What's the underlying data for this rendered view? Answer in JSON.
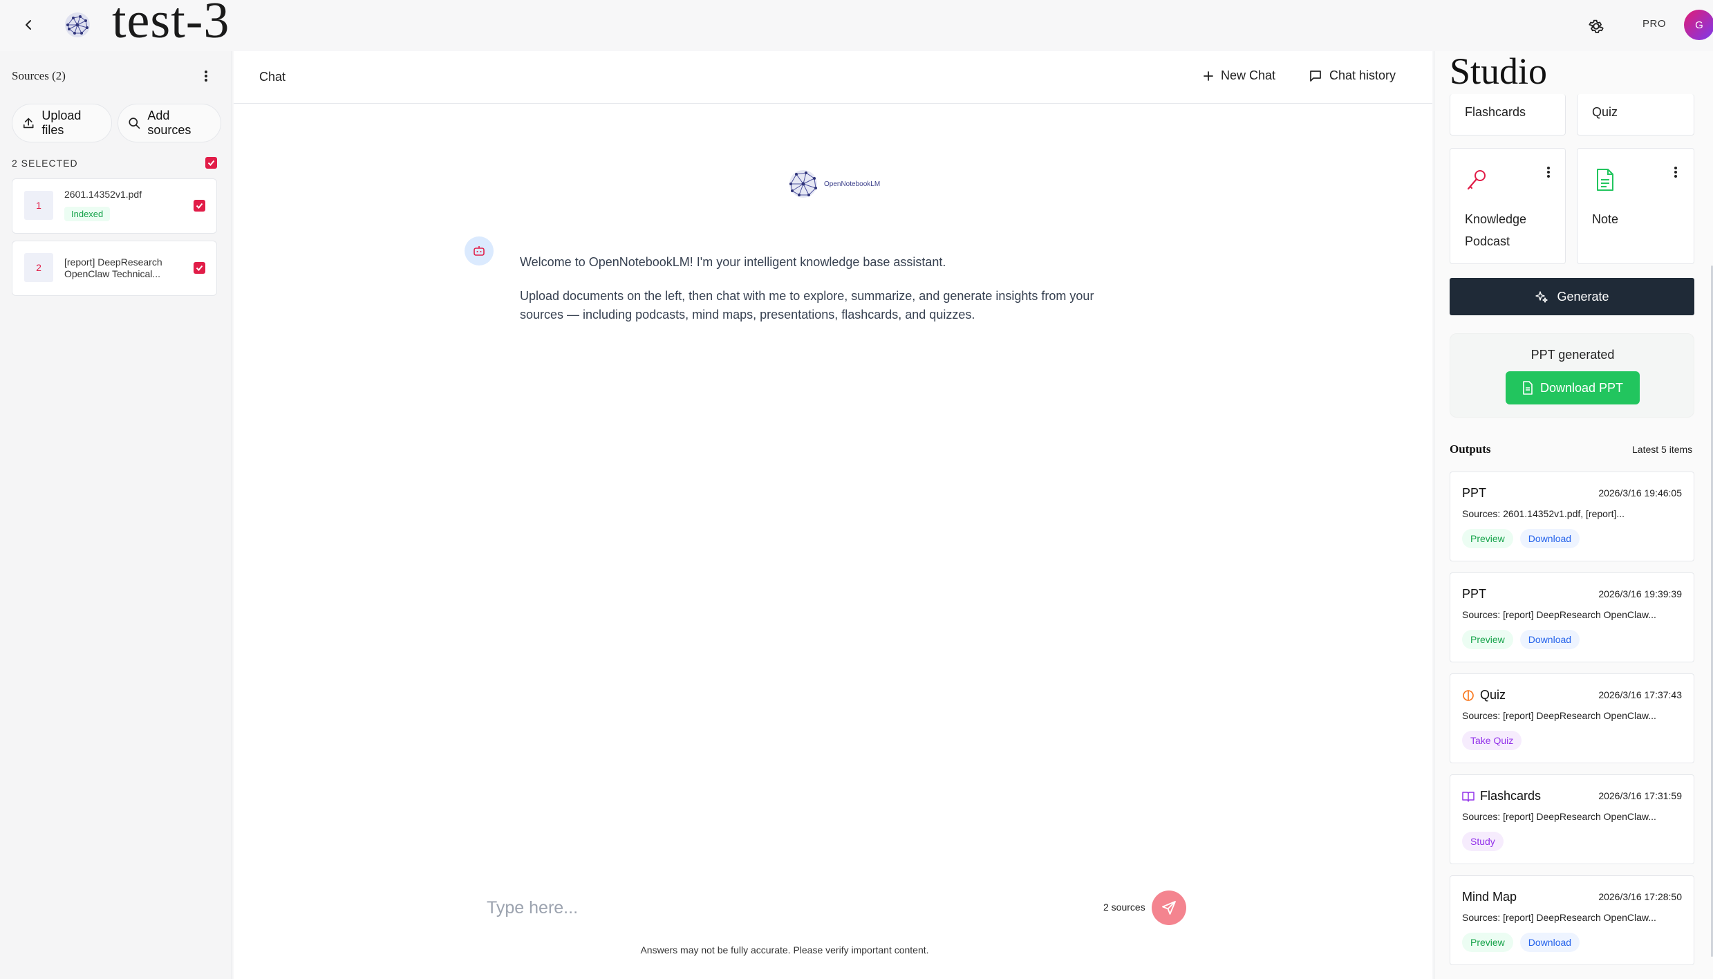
{
  "header": {
    "notebook_title": "test-3",
    "pro_label": "PRO",
    "avatar_initial": "G"
  },
  "sources_panel": {
    "title": "Sources (2)",
    "upload_label": "Upload files",
    "add_label": "Add sources",
    "selected_label": "2 SELECTED",
    "items": [
      {
        "number": "1",
        "name": "2601.14352v1.pdf",
        "status": "Indexed"
      },
      {
        "number": "2",
        "name_line1": "[report] DeepResearch",
        "name_line2": "OpenClaw Technical..."
      }
    ]
  },
  "chat": {
    "title": "Chat",
    "new_chat_label": "New Chat",
    "history_label": "Chat history",
    "logo_text": "OpenNotebookLM",
    "welcome_line1": "Welcome to OpenNotebookLM! I'm your intelligent knowledge base assistant.",
    "welcome_line2": "Upload documents on the left, then chat with me to explore, summarize, and generate insights from your sources — including podcasts, mind maps, presentations, flashcards, and quizzes.",
    "input_placeholder": "Type here...",
    "source_count": "2 sources",
    "disclaimer": "Answers may not be fully accurate. Please verify important content."
  },
  "studio": {
    "title": "Studio",
    "tiles": {
      "flashcards": "Flashcards",
      "quiz": "Quiz",
      "knowledge_podcast_line1": "Knowledge",
      "knowledge_podcast_line2": "Podcast",
      "note": "Note"
    },
    "generate_label": "Generate",
    "ppt_status": "PPT generated",
    "download_ppt_label": "Download PPT",
    "outputs_title": "Outputs",
    "outputs_latest": "Latest 5 items",
    "outputs": [
      {
        "name": "PPT",
        "time": "2026/3/16 19:46:05",
        "sources": "Sources: 2601.14352v1.pdf, [report]...",
        "action1": "Preview",
        "action2": "Download"
      },
      {
        "name": "PPT",
        "time": "2026/3/16 19:39:39",
        "sources": "Sources: [report] DeepResearch OpenClaw...",
        "action1": "Preview",
        "action2": "Download"
      },
      {
        "name": "Quiz",
        "time": "2026/3/16 17:37:43",
        "sources": "Sources: [report] DeepResearch OpenClaw...",
        "action1": "Take Quiz"
      },
      {
        "name": "Flashcards",
        "time": "2026/3/16 17:31:59",
        "sources": "Sources: [report] DeepResearch OpenClaw...",
        "action1": "Study"
      },
      {
        "name": "Mind Map",
        "time": "2026/3/16 17:28:50",
        "sources": "Sources: [report] DeepResearch OpenClaw...",
        "action1": "Preview",
        "action2": "Download"
      }
    ]
  },
  "colors": {
    "accent_red": "#e11d48",
    "generate_bg": "#1f2a37",
    "success_green": "#22c55e"
  }
}
